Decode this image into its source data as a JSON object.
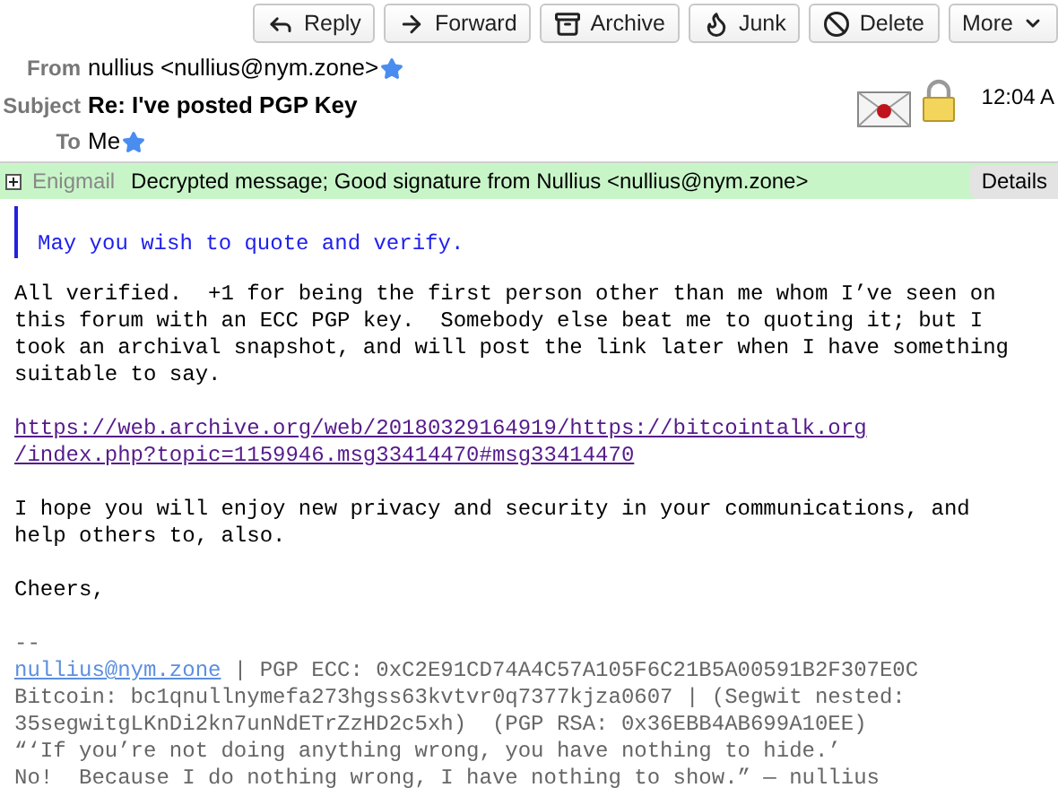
{
  "toolbar": [
    {
      "label": "Reply"
    },
    {
      "label": "Forward"
    },
    {
      "label": "Archive"
    },
    {
      "label": "Junk"
    },
    {
      "label": "Delete"
    },
    {
      "label": "More"
    }
  ],
  "header": {
    "from_label": "From",
    "from": "nullius <nullius@nym.zone>",
    "from_starred": true,
    "subject_label": "Subject",
    "subject": "Re: I've posted PGP Key",
    "to_label": "To",
    "to": "Me",
    "to_starred": true,
    "time": "12:04 A"
  },
  "enigmail": {
    "label": "Enigmail",
    "message": "Decrypted message; Good signature from Nullius <nullius@nym.zone>",
    "details": "Details"
  },
  "body": [
    {
      "kind": "quote",
      "text": "May you wish to quote and verify."
    },
    {
      "kind": "text",
      "text": "All verified.  +1 for being the first person other than me whom I’ve seen on\nthis forum with an ECC PGP key.  Somebody else beat me to quoting it; but I\ntook an archival snapshot, and will post the link later when I have something\nsuitable to say."
    },
    {
      "kind": "link",
      "text": "https://web.archive.org/web/20180329164919/https://bitcointalk.org\n/index.php?topic=1159946.msg33414470#msg33414470"
    },
    {
      "kind": "text",
      "text": "I hope you will enjoy new privacy and security in your communications, and\nhelp others to, also."
    },
    {
      "kind": "text",
      "text": "Cheers,"
    }
  ],
  "signature": {
    "separator": "--",
    "email": "nullius@nym.zone",
    "lines": [
      " | PGP ECC: 0xC2E91CD74A4C57A105F6C21B5A00591B2F307E0C",
      "Bitcoin: bc1qnullnymefa273hgss63kvtvr0q7377kjza0607 | (Segwit nested:\n35segwitgLKnDi2kn7unNdETrZzHD2c5xh)  (PGP RSA: 0x36EBB4AB699A10EE)\n“‘If you’re not doing anything wrong, you have nothing to hide.’\nNo!  Because I do nothing wrong, I have nothing to show.” — nullius"
    ]
  }
}
